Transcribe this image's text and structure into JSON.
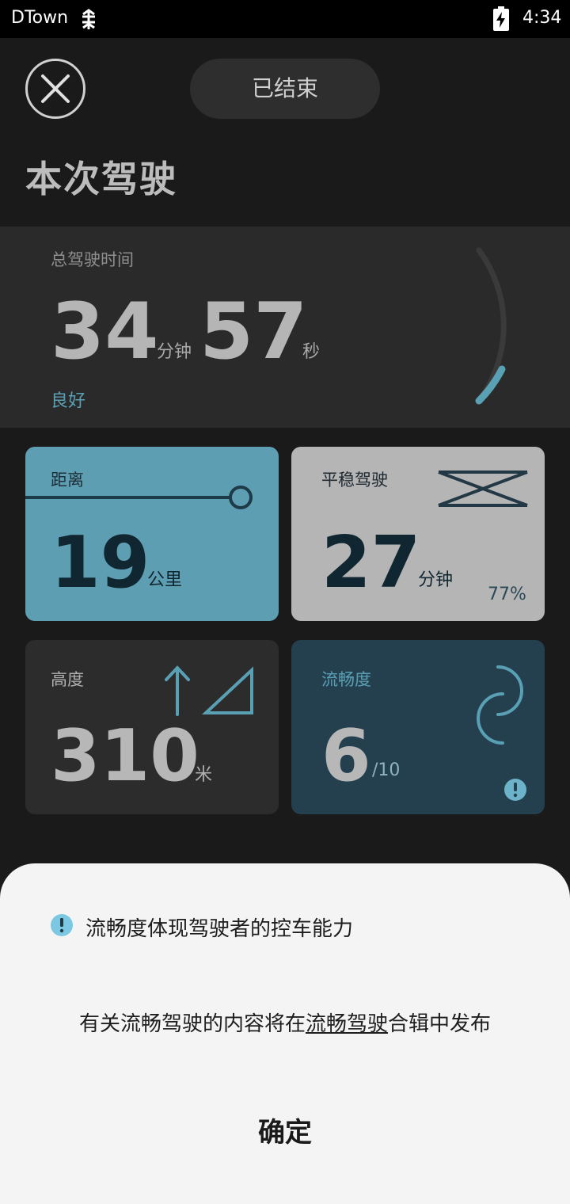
{
  "status_bar": {
    "carrier": "DTown",
    "time": "4:34",
    "network_icon": "network-tower-icon",
    "battery_icon": "battery-charging-icon"
  },
  "header": {
    "close_icon": "close-icon",
    "status": "已结束",
    "title": "本次驾驶"
  },
  "summary": {
    "label": "总驾驶时间",
    "minutes": "34",
    "minutes_unit": "分钟",
    "seconds": "57",
    "seconds_unit": "秒",
    "rating": "良好",
    "gauge_fraction": 0.2,
    "accent_color": "#5aa0b5"
  },
  "cards": {
    "distance": {
      "label": "距离",
      "value": "19",
      "unit": "公里",
      "color": "#5e9eb3"
    },
    "smooth": {
      "label": "平稳驾驶",
      "value": "27",
      "unit": "分钟",
      "percent": "77%",
      "color": "#b5b5b5"
    },
    "altitude": {
      "label": "高度",
      "value": "310",
      "unit": "米",
      "color": "#2c2c2c"
    },
    "fluency": {
      "label": "流畅度",
      "value": "6",
      "unit": "/10",
      "color": "#24404f"
    }
  },
  "sheet": {
    "title": "流畅度体现驾驶者的控车能力",
    "body_before": "有关流畅驾驶的内容将在",
    "body_link": "流畅驾驶",
    "body_after": "合辑中发布",
    "confirm": "确定"
  }
}
